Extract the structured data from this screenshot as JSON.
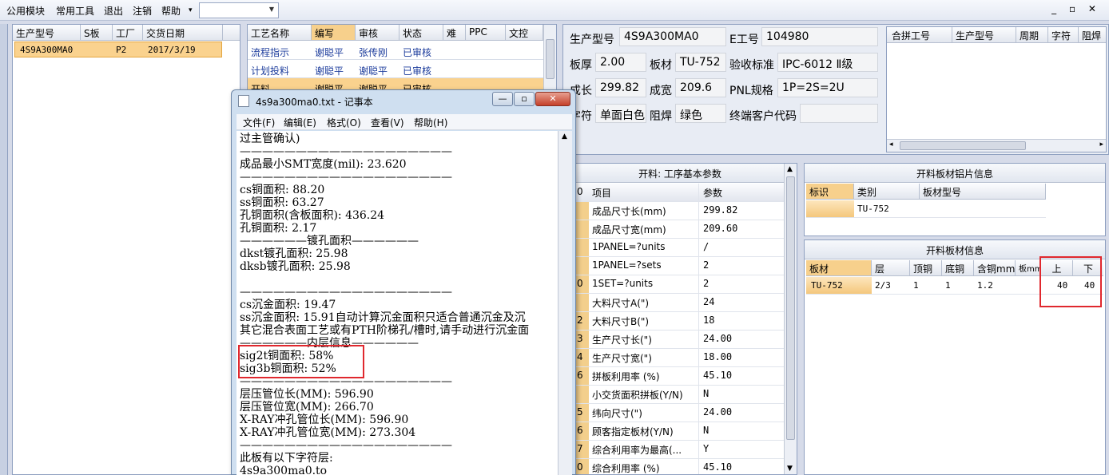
{
  "menubar": {
    "items": [
      "公用模块",
      "常用工具",
      "退出",
      "注销",
      "帮助"
    ],
    "help_arrow": "▾",
    "combo_value": "",
    "window_controls": "_ ▫ ✕"
  },
  "list_panel": {
    "headers": [
      "生产型号",
      "S板",
      "工厂",
      "交货日期"
    ],
    "rows": [
      {
        "model": "4S9A300MA0",
        "s_board": "",
        "factory": "P2",
        "delivery_date": "2017/3/19"
      }
    ]
  },
  "process_list": {
    "headers": [
      "工艺名称",
      "编写",
      "审核",
      "状态",
      "难",
      "PPC",
      "文控"
    ],
    "rows": [
      {
        "name": "流程指示",
        "writer": "谢聪平",
        "reviewer": "张传刚",
        "status": "已审核"
      },
      {
        "name": "计划投料",
        "writer": "谢聪平",
        "reviewer": "谢聪平",
        "status": "已审核"
      },
      {
        "name": "开料",
        "writer": "谢聪平",
        "reviewer": "谢聪平",
        "status": "已审核"
      }
    ]
  },
  "info": {
    "model_label": "生产型号",
    "model_value": "4S9A300MA0",
    "e_label": "E工号",
    "e_value": "104980",
    "thick_label": "板厚",
    "thick_value": "2.00",
    "mat_label": "板材",
    "mat_value": "TU-752",
    "std_label": "验收标准",
    "std_value": "IPC-6012 Ⅱ级",
    "len_label": "成长",
    "len_value": "299.82",
    "wid_label": "成宽",
    "wid_value": "209.6",
    "pnl_label": "PNL规格",
    "pnl_value": "1P=2S=2U",
    "char_label": "字符",
    "char_value": "单面白色",
    "mask_label": "阻焊",
    "mask_value": "绿色",
    "cust_label": "终端客户代码",
    "cust_value": ""
  },
  "combo_grid": {
    "headers": [
      "合拼工号",
      "生产型号",
      "周期",
      "字符",
      "阻焊"
    ]
  },
  "params": {
    "title": "开料: 工序基本参数",
    "headers": [
      "项目",
      "参数"
    ],
    "header_index": "0",
    "rows": [
      {
        "idx": "",
        "name": "成品尺寸长(mm)",
        "value": "299.82"
      },
      {
        "idx": "",
        "name": "成品尺寸宽(mm)",
        "value": "209.60"
      },
      {
        "idx": "",
        "name": "1PANEL=?units",
        "value": "/"
      },
      {
        "idx": "",
        "name": "1PANEL=?sets",
        "value": "2"
      },
      {
        "idx": "0",
        "name": "1SET=?units",
        "value": "2"
      },
      {
        "idx": "",
        "name": "大料尺寸A(\")",
        "value": "24"
      },
      {
        "idx": "2",
        "name": "大料尺寸B(\")",
        "value": "18"
      },
      {
        "idx": "3",
        "name": "生产尺寸长(\")",
        "value": "24.00"
      },
      {
        "idx": "4",
        "name": "生产尺寸宽(\")",
        "value": "18.00"
      },
      {
        "idx": "6",
        "name": "拼板利用率 (%)",
        "value": "45.10"
      },
      {
        "idx": "",
        "name": "小交货面积拼板(Y/N)",
        "value": "N"
      },
      {
        "idx": "5",
        "name": "纬向尺寸(\")",
        "value": "24.00"
      },
      {
        "idx": "6",
        "name": "顾客指定板材(Y/N)",
        "value": "N"
      },
      {
        "idx": "7",
        "name": "综合利用率为最高(...",
        "value": "Y"
      },
      {
        "idx": "0",
        "name": "综合利用率 (%)",
        "value": "45.10"
      }
    ]
  },
  "material": {
    "title": "开料板材铝片信息",
    "headers": [
      "标识",
      "类别",
      "板材型号"
    ],
    "row": {
      "mark": "",
      "type": "TU-752",
      "model": ""
    }
  },
  "sheet": {
    "title": "开料板材信息",
    "headers": [
      "板材",
      "层",
      "顶铜",
      "底铜",
      "含铜mm",
      "板mm",
      "上",
      "下"
    ],
    "row": {
      "board": "TU-752",
      "layer": "2/3",
      "top": "1",
      "bottom": "1",
      "cu": "1.2",
      "bmm": "",
      "up": "40",
      "down": "40"
    }
  },
  "notepad": {
    "title": "4s9a300ma0.txt - 记事本",
    "menu": [
      "文件(F)",
      "编辑(E)",
      "格式(O)",
      "查看(V)",
      "帮助(H)"
    ],
    "lines": [
      "过主管确认)",
      "———————————————————",
      "",
      "成品最小SMT宽度(mil): 23.620",
      "———————————————————",
      "",
      "cs铜面积: 88.20",
      "ss铜面积: 63.27",
      "孔铜面积(含板面积): 436.24",
      "孔铜面积: 2.17",
      "——————镀孔面积——————",
      "dkst镀孔面积: 25.98",
      "dksb镀孔面积: 25.98",
      "",
      "———————————————————",
      "",
      "cs沉金面积: 19.47",
      "ss沉金面积: 15.91自动计算沉金面积只适合普通沉金及沉",
      "其它混合表面工艺或有PTH阶梯孔/槽时,请手动进行沉金面",
      "——————内层信息——————",
      "sig2t铜面积: 58%",
      "sig3b铜面积: 52%",
      "———————————————————",
      "",
      "层压管位长(MM): 596.90",
      "层压管位宽(MM): 266.70",
      "X-RAY冲孔管位长(MM): 596.90",
      "X-RAY冲孔管位宽(MM): 273.304",
      "———————————————————",
      "",
      "此板有以下字符层:",
      "4s9a300ma0.to"
    ]
  }
}
